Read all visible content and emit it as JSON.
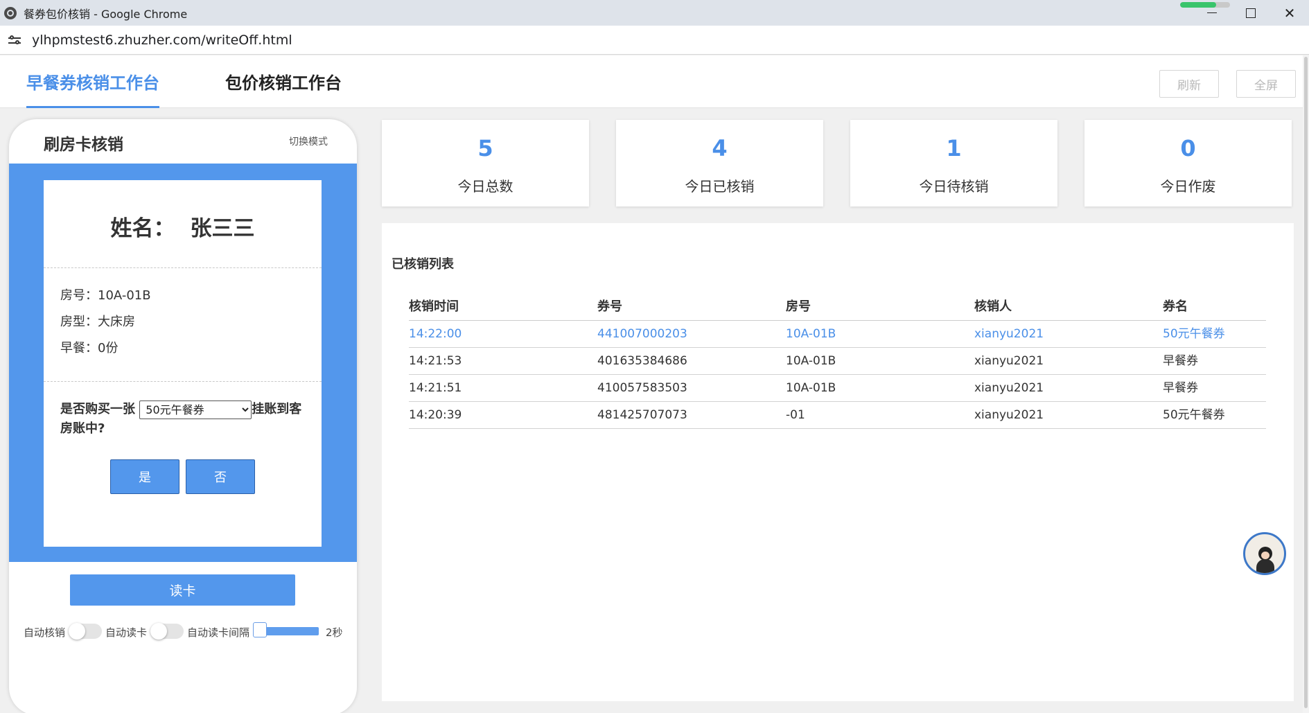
{
  "window": {
    "title": "餐券包价核销 - Google Chrome",
    "url": "ylhpmstest6.zhuzher.com/writeOff.html"
  },
  "header": {
    "tabs": [
      {
        "label": "早餐券核销工作台",
        "active": true
      },
      {
        "label": "包价核销工作台",
        "active": false
      }
    ],
    "refresh_label": "刷新",
    "fullscreen_label": "全屏"
  },
  "phone": {
    "title": "刷房卡核销",
    "switch_mode": "切换模式",
    "name_label": "姓名：",
    "name_value": "张三三",
    "room_no": "房号：10A-01B",
    "room_type": "房型：大床房",
    "breakfast": "早餐：0份",
    "question_prefix": "是否购买一张",
    "question_suffix": "挂账到客房账中?",
    "select_value": "50元午餐券",
    "yes_label": "是",
    "no_label": "否",
    "read_card_label": "读卡",
    "auto_writeoff_label": "自动核销",
    "auto_read_label": "自动读卡",
    "auto_interval_label": "自动读卡间隔",
    "interval_value": "2秒"
  },
  "stats": [
    {
      "value": "5",
      "label": "今日总数"
    },
    {
      "value": "4",
      "label": "今日已核销"
    },
    {
      "value": "1",
      "label": "今日待核销"
    },
    {
      "value": "0",
      "label": "今日作废"
    }
  ],
  "list": {
    "title": "已核销列表",
    "columns": [
      "核销时间",
      "券号",
      "房号",
      "核销人",
      "券名"
    ],
    "rows": [
      [
        "14:22:00",
        "441007000203",
        "10A-01B",
        "xianyu2021",
        "50元午餐券"
      ],
      [
        "14:21:53",
        "401635384686",
        "10A-01B",
        "xianyu2021",
        "早餐券"
      ],
      [
        "14:21:51",
        "410057583503",
        "10A-01B",
        "xianyu2021",
        "早餐券"
      ],
      [
        "14:20:39",
        "481425707073",
        "-01",
        "xianyu2021",
        "50元午餐券"
      ]
    ]
  },
  "colors": {
    "accent": "#4a8fe8",
    "phone_blue": "#5397ec"
  }
}
